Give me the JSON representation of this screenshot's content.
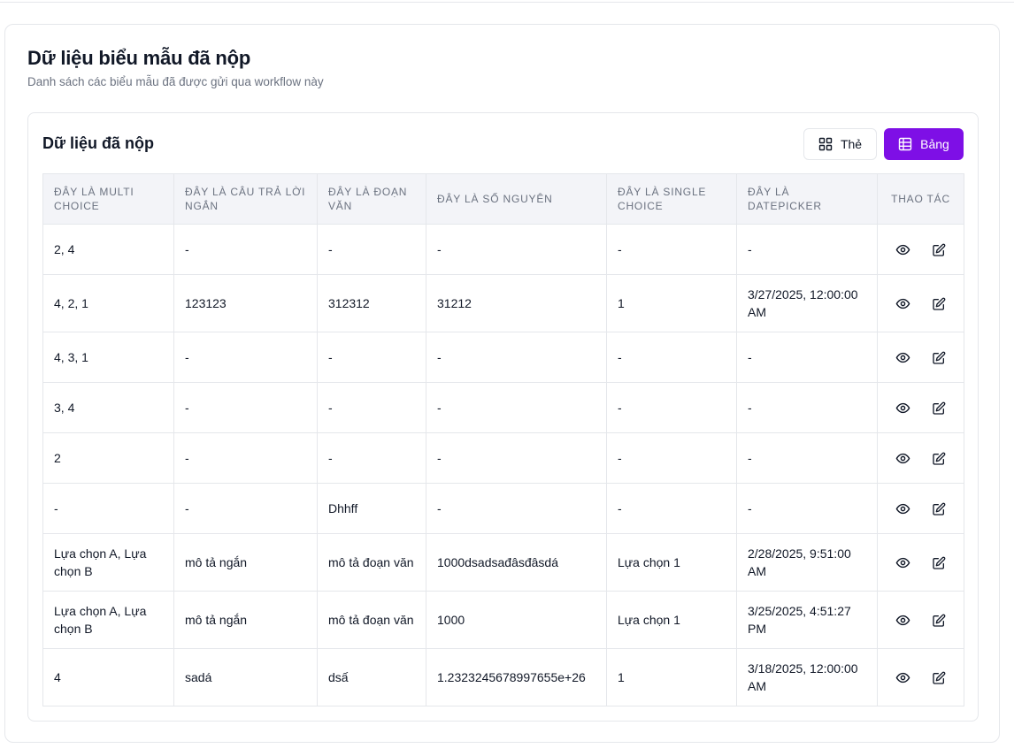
{
  "page": {
    "title": "Dữ liệu biểu mẫu đã nộp",
    "subtitle": "Danh sách các biểu mẫu đã được gửi qua workflow này"
  },
  "panel": {
    "title": "Dữ liệu đã nộp",
    "view_toggle": {
      "cards_label": "Thẻ",
      "table_label": "Bảng",
      "active": "table",
      "active_color": "#7e0fe6"
    }
  },
  "table": {
    "headers": [
      "Đây là multi choice",
      "Đây là câu trả lời ngắn",
      "Đây là đoạn văn",
      "Đây là số nguyên",
      "Đây là single choice",
      "Đây là datepicker",
      "Thao tác"
    ],
    "rows": [
      [
        "2, 4",
        "-",
        "-",
        "-",
        "-",
        "-"
      ],
      [
        "4, 2, 1",
        "123123",
        "312312",
        "31212",
        "1",
        "3/27/2025, 12:00:00 AM"
      ],
      [
        "4, 3, 1",
        "-",
        "-",
        "-",
        "-",
        "-"
      ],
      [
        "3, 4",
        "-",
        "-",
        "-",
        "-",
        "-"
      ],
      [
        "2",
        "-",
        "-",
        "-",
        "-",
        "-"
      ],
      [
        "-",
        "-",
        "Dhhff",
        "-",
        "-",
        "-"
      ],
      [
        "Lựa chọn A, Lựa chọn B",
        "mô tả ngắn",
        "mô tả đoạn văn",
        "1000dsadsađâsđâsdá",
        "Lựa chọn 1",
        "2/28/2025, 9:51:00 AM"
      ],
      [
        "Lựa chọn A, Lựa chọn B",
        "mô tả ngắn",
        "mô tả đoạn văn",
        "1000",
        "Lựa chọn 1",
        "3/25/2025, 4:51:27 PM"
      ],
      [
        "4",
        "sadá",
        "dsấ",
        "1.2323245678997655e+26",
        "1",
        "3/18/2025, 12:00:00 AM"
      ]
    ],
    "row_actions": [
      "eye-icon",
      "edit-icon"
    ]
  }
}
